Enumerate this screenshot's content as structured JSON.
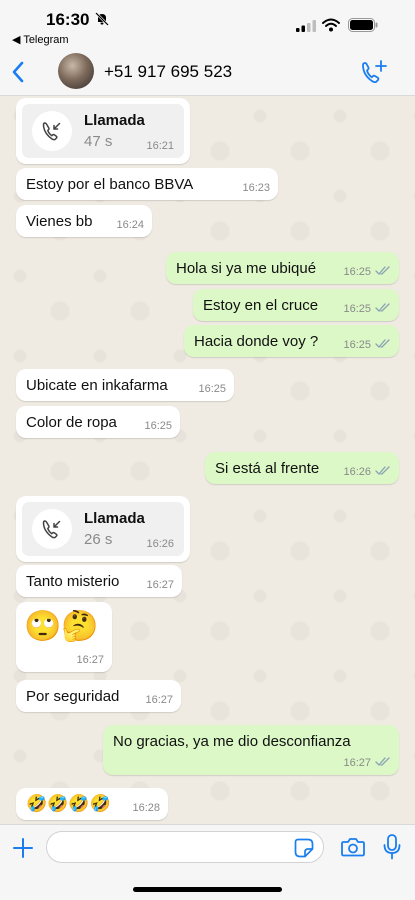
{
  "status_bar": {
    "time": "16:30",
    "back_app": "◀ Telegram"
  },
  "header": {
    "contact": "+51 917 695 523"
  },
  "colors": {
    "accent": "#1a7ef0",
    "incoming_bg": "#ffffff",
    "outgoing_bg": "#dcf8c6",
    "chat_bg": "#efeae2"
  },
  "messages": [
    {
      "dir": "in",
      "type": "call",
      "title": "Llamada",
      "duration": "47 s",
      "time": "16:21"
    },
    {
      "dir": "in",
      "text": "Estoy por el banco BBVA",
      "time": "16:23"
    },
    {
      "dir": "in",
      "text": "Vienes bb",
      "time": "16:24"
    },
    {
      "dir": "out",
      "text": "Hola si ya me ubiqué",
      "time": "16:25",
      "status": "read"
    },
    {
      "dir": "out",
      "text": "Estoy en el cruce",
      "time": "16:25",
      "status": "read"
    },
    {
      "dir": "out",
      "text": "Hacia donde voy ?",
      "time": "16:25",
      "status": "read"
    },
    {
      "dir": "in",
      "text": "Ubicate en inkafarma",
      "time": "16:25"
    },
    {
      "dir": "in",
      "text": "Color de ropa",
      "time": "16:25"
    },
    {
      "dir": "out",
      "text": "Si está al frente",
      "time": "16:26",
      "status": "read"
    },
    {
      "dir": "in",
      "type": "call",
      "title": "Llamada",
      "duration": "26 s",
      "time": "16:26"
    },
    {
      "dir": "in",
      "text": "Tanto misterio",
      "time": "16:27"
    },
    {
      "dir": "in",
      "text": "🙄🤔",
      "time": "16:27"
    },
    {
      "dir": "in",
      "text": "Por seguridad",
      "time": "16:27"
    },
    {
      "dir": "out",
      "text": "No gracias, ya me dio desconfianza",
      "time": "16:27",
      "status": "read"
    },
    {
      "dir": "in",
      "text": "🤣🤣🤣🤣",
      "time": "16:28"
    }
  ],
  "input": {
    "placeholder": ""
  },
  "icons": [
    "mute-bell-icon",
    "signal-icon",
    "wifi-icon",
    "battery-icon",
    "back-chevron-icon",
    "add-call-icon",
    "incoming-call-icon",
    "double-check-icon",
    "plus-icon",
    "sticker-icon",
    "camera-icon",
    "microphone-icon"
  ]
}
